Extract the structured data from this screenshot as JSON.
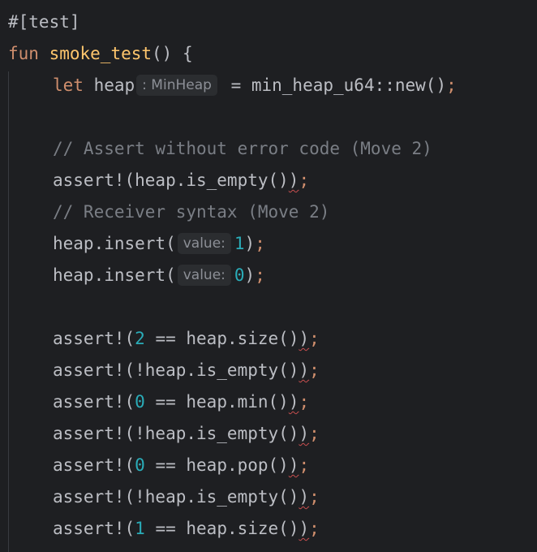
{
  "editor": {
    "attribute": "#[test]",
    "fn_keyword": "fun",
    "fn_name": "smoke_test",
    "fn_open": "() {",
    "line_let": {
      "keyword": "let",
      "var": "heap",
      "type_hint": ": MinHeap",
      "rest": "= min_heap_u64::new()",
      "semi": ";"
    },
    "comment1": "// Assert without error code (Move 2)",
    "assert_empty": {
      "head": "assert!(heap.is_empty()",
      "close": ")",
      "semi": ";"
    },
    "comment2": "// Receiver syntax (Move 2)",
    "insert1": {
      "head": "heap.insert(",
      "hint": "value:",
      "value": "1",
      "close": ")",
      "semi": ";"
    },
    "insert2": {
      "head": "heap.insert(",
      "hint": "value:",
      "value": "0",
      "close": ")",
      "semi": ";"
    },
    "assert_size2": {
      "head": "assert!(",
      "num": "2",
      "mid": " == heap.size()",
      "close": ")",
      "semi": ";"
    },
    "assert_not_empty1": {
      "head": "assert!(!heap.is_empty()",
      "close": ")",
      "semi": ";"
    },
    "assert_min": {
      "head": "assert!(",
      "num": "0",
      "mid": " == heap.min()",
      "close": ")",
      "semi": ";"
    },
    "assert_not_empty2": {
      "head": "assert!(!heap.is_empty()",
      "close": ")",
      "semi": ";"
    },
    "assert_pop": {
      "head": "assert!(",
      "num": "0",
      "mid": " == heap.pop()",
      "close": ")",
      "semi": ";"
    },
    "assert_not_empty3": {
      "head": "assert!(!heap.is_empty()",
      "close": ")",
      "semi": ";"
    },
    "assert_size1": {
      "head": "assert!(",
      "num": "1",
      "mid": " == heap.size()",
      "close": ")",
      "semi": ";"
    }
  }
}
